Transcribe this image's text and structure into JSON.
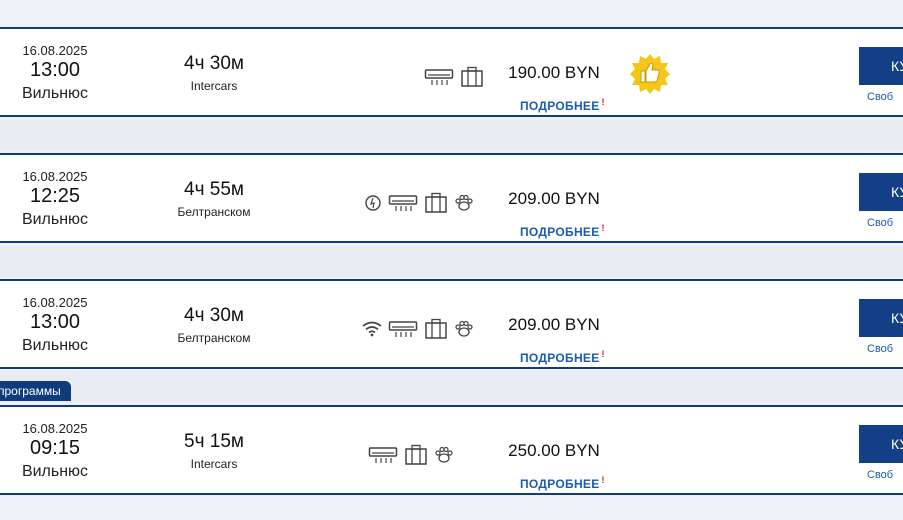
{
  "trips": [
    {
      "date": "16.08.2025",
      "time": "13:00",
      "city": "Вильнюс",
      "duration": "4ч 30м",
      "carrier": "Intercars",
      "amenities": [
        "air-conditioner-icon",
        "luggage-icon"
      ],
      "price": "190.00 BYN",
      "details_label": "ПОДРОБНЕЕ",
      "details_marker": "!",
      "buy_label": "КУ",
      "seats_label": "Своб",
      "badge": "thumbs-up-badge-icon"
    },
    {
      "date": "16.08.2025",
      "time": "12:25",
      "city": "Вильнюс",
      "duration": "4ч 55м",
      "carrier": "Белтранском",
      "amenities": [
        "charging-icon",
        "air-conditioner-icon",
        "luggage-icon",
        "pet-paw-icon"
      ],
      "price": "209.00 BYN",
      "details_label": "ПОДРОБНЕЕ",
      "details_marker": "!",
      "buy_label": "КУ",
      "seats_label": "Своб"
    },
    {
      "date": "16.08.2025",
      "time": "13:00",
      "city": "Вильнюс",
      "duration": "4ч 30м",
      "carrier": "Белтранском",
      "amenities": [
        "wifi-icon",
        "air-conditioner-icon",
        "luggage-icon",
        "pet-paw-icon"
      ],
      "price": "209.00 BYN",
      "details_label": "ПОДРОБНЕЕ",
      "details_marker": "!",
      "buy_label": "КУ",
      "seats_label": "Своб"
    },
    {
      "tag": "программы",
      "date": "16.08.2025",
      "time": "09:15",
      "city": "Вильнюс",
      "duration": "5ч 15м",
      "carrier": "Intercars",
      "amenities": [
        "air-conditioner-icon",
        "luggage-icon",
        "pet-paw-icon"
      ],
      "price": "250.00 BYN",
      "details_label": "ПОДРОБНЕЕ",
      "details_marker": "!",
      "buy_label": "КУ",
      "seats_label": "Своб"
    }
  ],
  "colors": {
    "accent": "#0f3c7d",
    "link": "#1a5cb0",
    "badge": "#f5c518",
    "marker": "#d01a1a"
  }
}
